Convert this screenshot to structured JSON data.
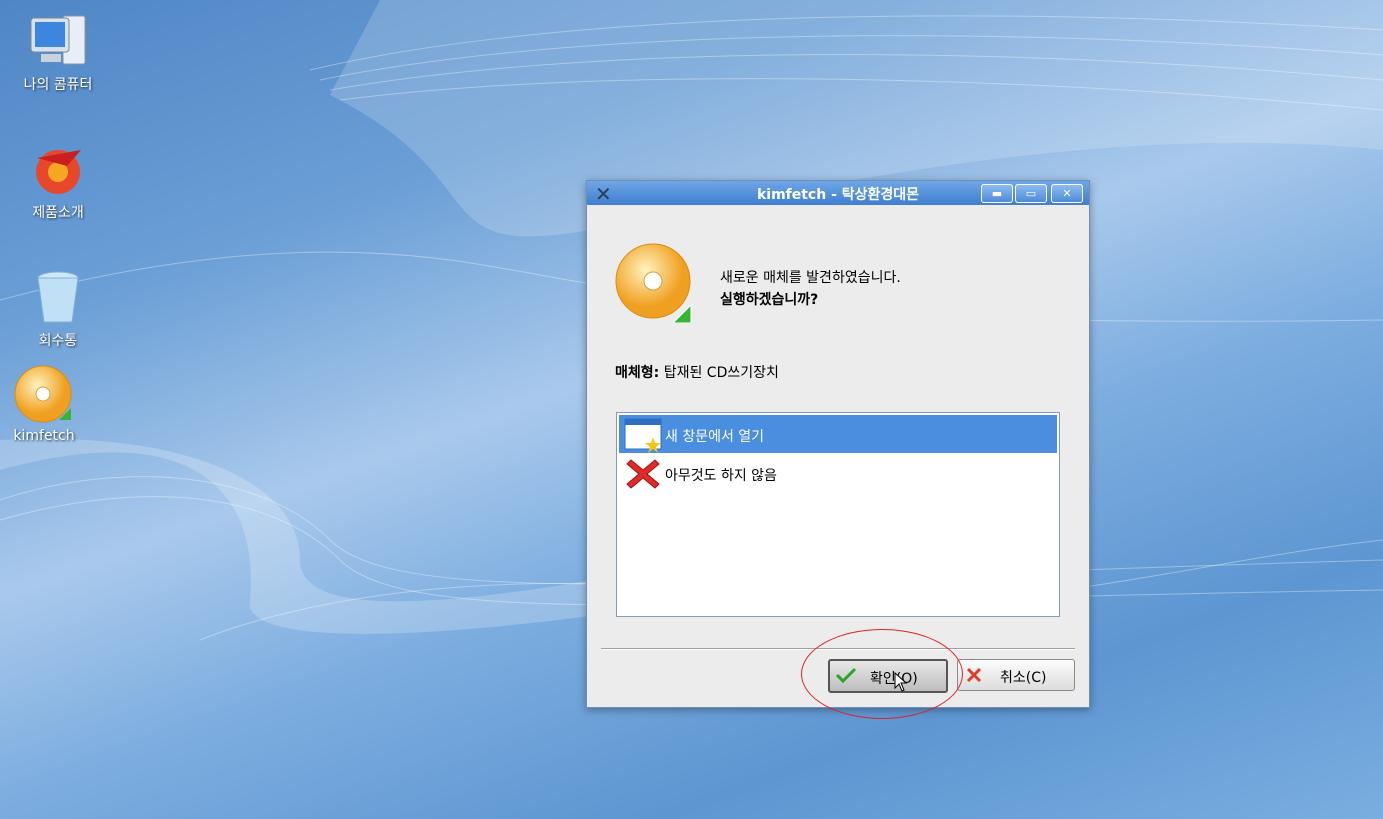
{
  "desktop": {
    "icons": [
      {
        "label": "나의 콤퓨터"
      },
      {
        "label": "제품소개"
      },
      {
        "label": "회수통"
      },
      {
        "label": "kimfetch"
      }
    ]
  },
  "dialog": {
    "title": "kimfetch - 탁상환경대몬",
    "controls": {
      "minimize": "▬",
      "maximize": "▭",
      "close": "✕"
    },
    "message_line1": "새로운 매체를 발견하였습니다.",
    "message_line2": "실행하겠습니까?",
    "media_label": "매체형:",
    "media_value": "탑재된 CD쓰기장치",
    "options": [
      {
        "label": "새 창문에서 열기",
        "selected": true
      },
      {
        "label": "아무것도 하지 않음",
        "selected": false
      }
    ],
    "ok_label": "확인(O)",
    "cancel_label": "취소(C)"
  }
}
